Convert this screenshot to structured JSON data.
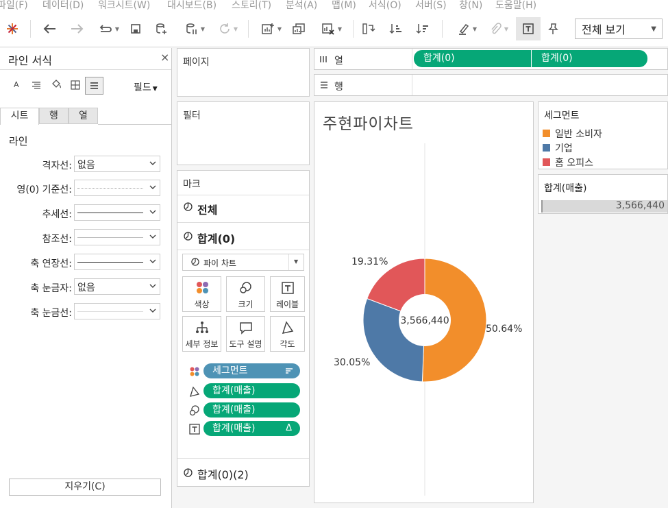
{
  "menu": [
    "파일(F)",
    "데이터(D)",
    "워크시트(W)",
    "대시보드(B)",
    "스토리(T)",
    "분석(A)",
    "맵(M)",
    "서식(O)",
    "서버(S)",
    "창(N)",
    "도움말(H)"
  ],
  "toolbar": {
    "view_select": "전체 보기"
  },
  "format_panel": {
    "title": "라인 서식",
    "close": "×",
    "fields_button": "필드",
    "tabs": [
      "시트",
      "행",
      "열"
    ],
    "section": "라인",
    "rows": [
      {
        "label": "격자선:",
        "value": "없음"
      },
      {
        "label": "영(0) 기준선:",
        "value": ""
      },
      {
        "label": "추세선:",
        "value": ""
      },
      {
        "label": "참조선:",
        "value": ""
      },
      {
        "label": "축 연장선:",
        "value": ""
      },
      {
        "label": "축 눈금자:",
        "value": "없음"
      },
      {
        "label": "축 눈금선:",
        "value": ""
      }
    ],
    "clear_button": "지우기(C)"
  },
  "cards": {
    "pages": "페이지",
    "filters": "필터",
    "marks": "마크",
    "all": "전체",
    "sum0": "합계(0)",
    "mark_type": "파이 차트",
    "buttons": [
      "색상",
      "크기",
      "레이블",
      "세부 정보",
      "도구 설명",
      "각도"
    ],
    "pills": [
      "세그먼트",
      "합계(매출)",
      "합계(매출)",
      "합계(매출)"
    ],
    "label_delta": "Δ",
    "sum0_2": "합계(0)(2)"
  },
  "shelves": {
    "columns_label": "열",
    "rows_label": "행",
    "column_pills": [
      "합계(0)",
      "합계(0)"
    ]
  },
  "view": {
    "title": "주현파이차트",
    "center_label": "3,566,440"
  },
  "chart_data": {
    "type": "pie",
    "title": "주현파이차트",
    "donut": true,
    "total": 3566440,
    "categories": [
      "일반 소비자",
      "기업",
      "홈 오피스"
    ],
    "values": [
      50.64,
      30.05,
      19.31
    ],
    "labels": [
      "50.64%",
      "30.05%",
      "19.31%"
    ],
    "colors": [
      "#f28e2b",
      "#4e79a7",
      "#e15759"
    ]
  },
  "legend": {
    "title": "세그먼트",
    "items": [
      {
        "label": "일반 소비자",
        "color": "#f28e2b"
      },
      {
        "label": "기업",
        "color": "#4e79a7"
      },
      {
        "label": "홈 오피스",
        "color": "#e15759"
      }
    ]
  },
  "size_legend": {
    "title": "합계(매출)",
    "value": "3,566,440"
  }
}
